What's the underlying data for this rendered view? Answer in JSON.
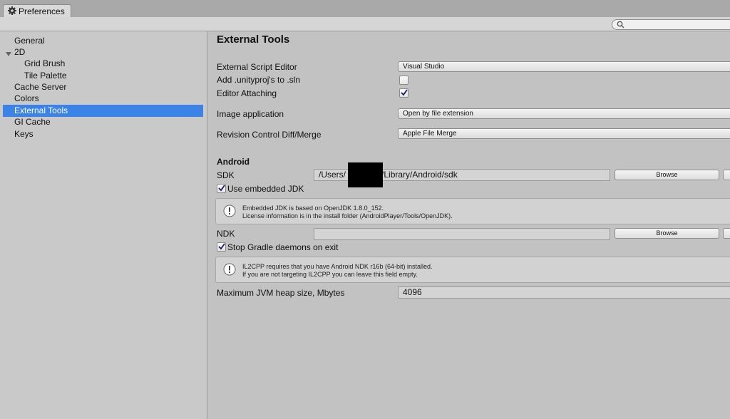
{
  "window": {
    "tab_title": "Preferences",
    "tab_icon": "gear-icon"
  },
  "toolbar": {
    "search_icon": "search-icon",
    "search_placeholder": ""
  },
  "sidebar": {
    "items": [
      {
        "label": "General"
      },
      {
        "label": "2D"
      },
      {
        "label": "Grid Brush"
      },
      {
        "label": "Tile Palette"
      },
      {
        "label": "Cache Server"
      },
      {
        "label": "Colors"
      },
      {
        "label": "External Tools"
      },
      {
        "label": "GI Cache"
      },
      {
        "label": "Keys"
      }
    ],
    "selected": "External Tools",
    "selected_color": "#3b83e6"
  },
  "main": {
    "title": "External Tools",
    "external_script_editor": {
      "label": "External Script Editor",
      "value": "Visual Studio"
    },
    "add_unityproj": {
      "label": "Add .unityproj's to .sln",
      "checked": false
    },
    "editor_attaching": {
      "label": "Editor Attaching",
      "checked": true
    },
    "image_application": {
      "label": "Image application",
      "value": "Open by file extension"
    },
    "revision_control": {
      "label": "Revision Control Diff/Merge",
      "value": "Apple File Merge"
    },
    "android": {
      "heading": "Android",
      "sdk": {
        "label": "SDK",
        "value_prefix": "/Users/",
        "value_suffix": "/Library/Android/sdk",
        "browse": "Browse"
      },
      "use_embedded_jdk": {
        "label": "Use embedded JDK",
        "checked": true
      },
      "jdk_help": {
        "line1": "Embedded JDK is based on OpenJDK 1.8.0_152.",
        "line2": "License information is in the install folder (AndroidPlayer/Tools/OpenJDK)."
      },
      "ndk": {
        "label": "NDK",
        "value": "",
        "browse": "Browse"
      },
      "stop_gradle": {
        "label": "Stop Gradle daemons on exit",
        "checked": true
      },
      "il2cpp_help": {
        "line1": "IL2CPP requires that you have Android NDK r16b (64-bit) installed.",
        "line2": "If you are not targeting IL2CPP you can leave this field empty."
      },
      "jvm_heap": {
        "label": "Maximum JVM heap size, Mbytes",
        "value": "4096"
      }
    }
  }
}
